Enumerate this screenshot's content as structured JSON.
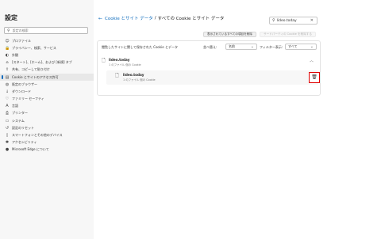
{
  "sidebar": {
    "title": "設定",
    "search_placeholder": "設定の検索",
    "items": [
      {
        "icon": "profile-icon",
        "glyph": "☺",
        "label": "プロファイル"
      },
      {
        "icon": "lock-icon",
        "glyph": "🔒",
        "label": "プライバシー、検索、サービス"
      },
      {
        "icon": "appearance-icon",
        "glyph": "◐",
        "label": "外観"
      },
      {
        "icon": "start-icon",
        "glyph": "⌂",
        "label": "[スタート]、[ホーム]、および [新規] タブ"
      },
      {
        "icon": "share-icon",
        "glyph": "⇪",
        "label": "共有、コピーして貼り付け"
      },
      {
        "icon": "cookies-icon",
        "glyph": "▤",
        "label": "Cookie とサイトのアクセス許可"
      },
      {
        "icon": "default-browser-icon",
        "glyph": "◍",
        "label": "既定のブラウザー"
      },
      {
        "icon": "download-icon",
        "glyph": "↓",
        "label": "ダウンロード"
      },
      {
        "icon": "family-icon",
        "glyph": "♡",
        "label": "ファミリー セーフティ"
      },
      {
        "icon": "language-icon",
        "glyph": "A",
        "label": "言語"
      },
      {
        "icon": "printer-icon",
        "glyph": "⎙",
        "label": "プリンター"
      },
      {
        "icon": "system-icon",
        "glyph": "▭",
        "label": "システム"
      },
      {
        "icon": "reset-icon",
        "glyph": "↺",
        "label": "設定のリセット"
      },
      {
        "icon": "phone-icon",
        "glyph": "▯",
        "label": "スマートフォンとその他のデバイス"
      },
      {
        "icon": "accessibility-icon",
        "glyph": "✱",
        "label": "アクセシビリティ"
      },
      {
        "icon": "edge-icon",
        "glyph": "●",
        "label": "Microsoft Edge について"
      }
    ],
    "active_index": 5
  },
  "header": {
    "back_glyph": "←",
    "breadcrumb_link": "Cookie とサイト データ",
    "separator": "/",
    "breadcrumb_current": "すべての Cookie とサイト データ"
  },
  "search": {
    "value": "lideo.today",
    "icon_glyph": "⚲",
    "clear_glyph": "✕"
  },
  "buttons": {
    "remove_shown": "表示されているすべての項目を削除",
    "remove_third_party": "サードパーティの Cookie を削除する"
  },
  "card": {
    "head": "閲覧したサイトに関して保存された Cookie とデータ",
    "sort_label": "並べ替え:",
    "sort_value": "名前",
    "filter_label": "フィルター表示:",
    "filter_value": "すべて",
    "site": {
      "name": "lideo.today",
      "sub": "1 のファイル 個の Cookie",
      "collapse_glyph": "︿"
    },
    "cookie": {
      "name": "lideo.today",
      "sub": "1 のファイル 個の Cookie",
      "delete_glyph": "🗑"
    }
  }
}
